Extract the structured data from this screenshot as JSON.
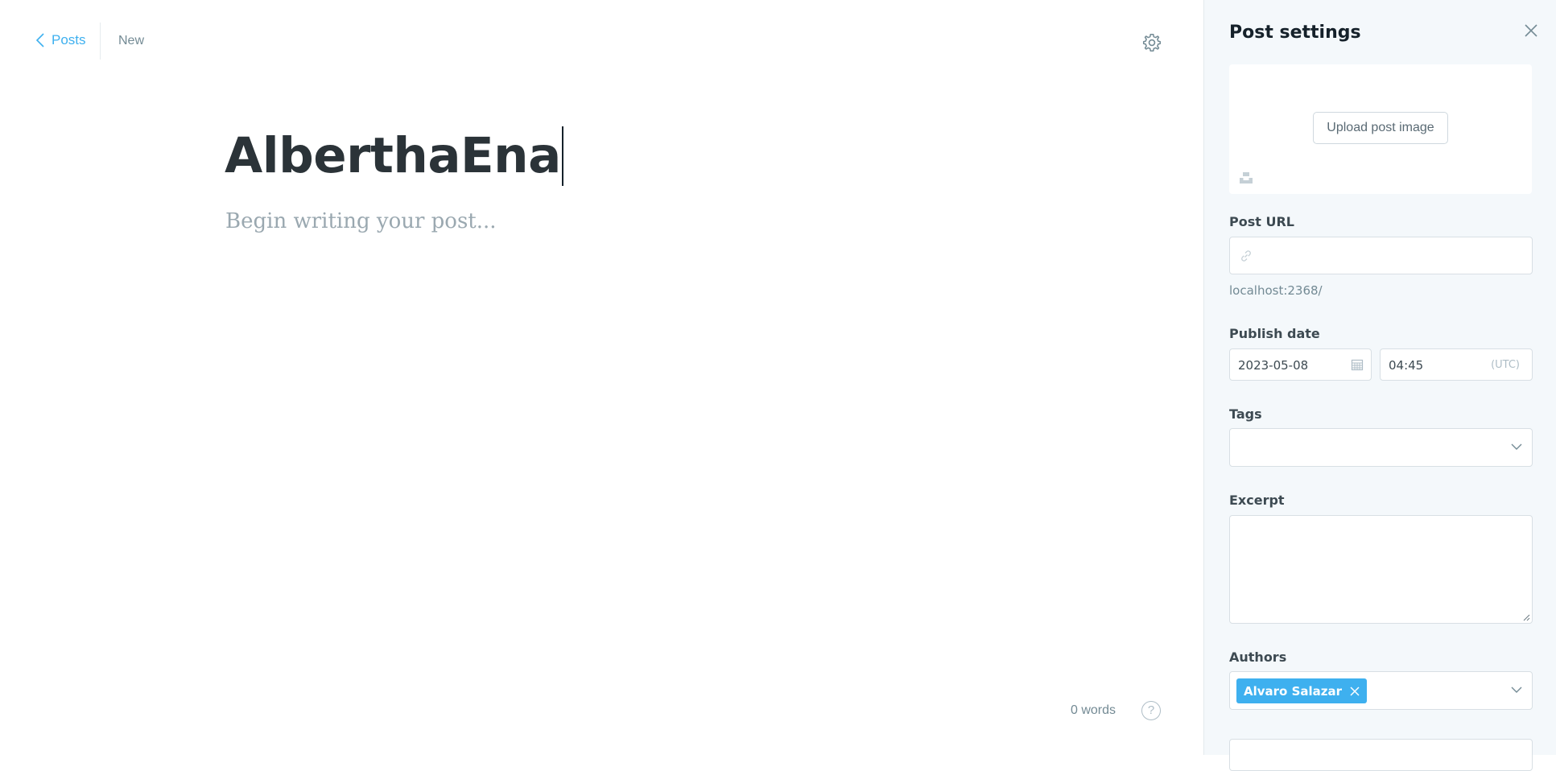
{
  "header": {
    "back_label": "Posts",
    "status": "New",
    "settings_icon": "gear-icon"
  },
  "editor": {
    "title": "AlberthaEna",
    "body_placeholder": "Begin writing your post...",
    "word_count": "0 words",
    "help_icon": "?"
  },
  "settings": {
    "title": "Post settings",
    "upload_label": "Upload post image",
    "post_url_label": "Post URL",
    "post_url_value": "",
    "post_url_hint": "localhost:2368/",
    "publish_date_label": "Publish date",
    "date_value": "2023-05-08",
    "time_value": "04:45",
    "timezone": "(UTC)",
    "tags_label": "Tags",
    "excerpt_label": "Excerpt",
    "excerpt_value": "",
    "authors_label": "Authors",
    "authors": [
      "Alvaro Salazar"
    ]
  },
  "colors": {
    "accent": "#3eb0ef",
    "panel_bg": "#f4f8fb",
    "text_dark": "#15212a",
    "muted": "#738a94"
  }
}
